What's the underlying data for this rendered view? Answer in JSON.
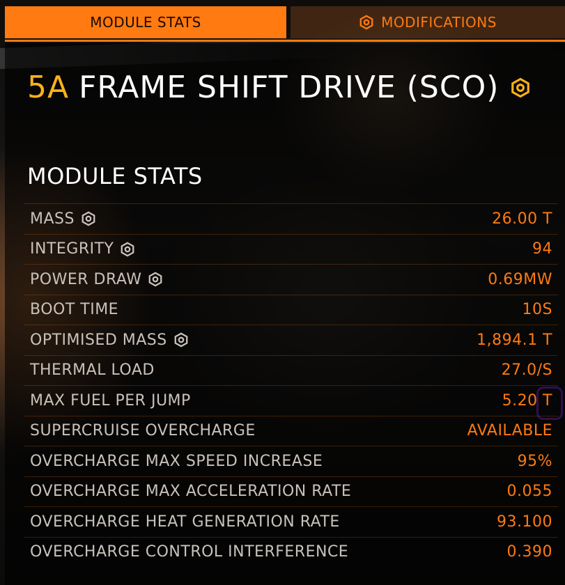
{
  "tabs": {
    "module_stats": "MODULE STATS",
    "modifications": "MODIFICATIONS"
  },
  "module": {
    "grade": "5A",
    "name": "FRAME SHIFT DRIVE (SCO)"
  },
  "section_title": "MODULE STATS",
  "stats": [
    {
      "label": "MASS",
      "value": "26.00 T",
      "engineered": true
    },
    {
      "label": "INTEGRITY",
      "value": "94",
      "engineered": true
    },
    {
      "label": "POWER DRAW",
      "value": "0.69MW",
      "engineered": true
    },
    {
      "label": "BOOT TIME",
      "value": "10S",
      "engineered": false
    },
    {
      "label": "OPTIMISED MASS",
      "value": "1,894.1 T",
      "engineered": true
    },
    {
      "label": "THERMAL LOAD",
      "value": "27.0/S",
      "engineered": false
    },
    {
      "label": "MAX FUEL PER JUMP",
      "value": "5.20 T",
      "engineered": false
    },
    {
      "label": "SUPERCRUISE OVERCHARGE",
      "value": "AVAILABLE",
      "engineered": false
    },
    {
      "label": "OVERCHARGE MAX SPEED INCREASE",
      "value": "95%",
      "engineered": false
    },
    {
      "label": "OVERCHARGE MAX ACCELERATION RATE",
      "value": "0.055",
      "engineered": false
    },
    {
      "label": "OVERCHARGE HEAT GENERATION RATE",
      "value": "93.100",
      "engineered": false
    },
    {
      "label": "OVERCHARGE CONTROL INTERFERENCE",
      "value": "0.390",
      "engineered": false
    }
  ],
  "colors": {
    "accent": "#ff7a10",
    "grade": "#ffb21a",
    "label": "#c9c2bb"
  },
  "icons": {
    "engineering": "engineering-hex-icon"
  }
}
